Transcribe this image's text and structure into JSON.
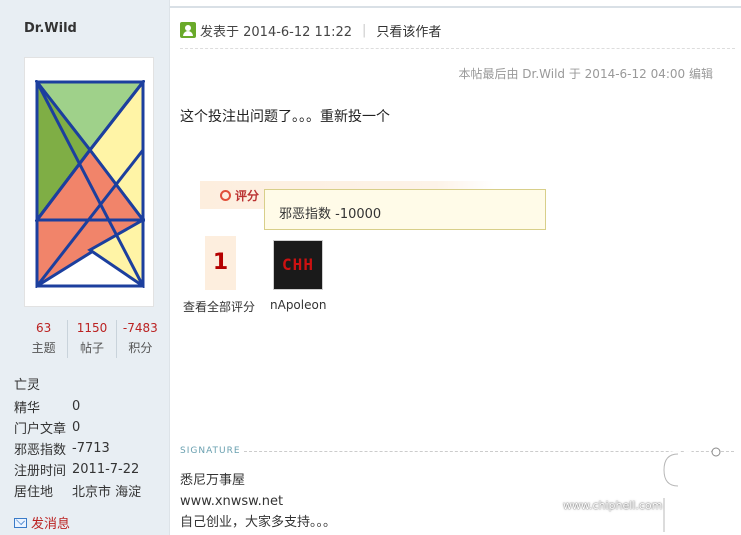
{
  "sidebar": {
    "username": "Dr.Wild",
    "stats": [
      {
        "value": "63",
        "label": "主题"
      },
      {
        "value": "1150",
        "label": "帖子"
      },
      {
        "value": "-7483",
        "label": "积分"
      }
    ],
    "rank": "亡灵",
    "profile": [
      {
        "key": "精华",
        "value": "0"
      },
      {
        "key": "门户文章",
        "value": "0"
      },
      {
        "key": "邪恶指数",
        "value": "-7713"
      },
      {
        "key": "注册时间",
        "value": "2011-7-22"
      },
      {
        "key": "居住地",
        "value": "北京市 海淀"
      }
    ],
    "send_message": "发消息"
  },
  "post": {
    "posted_at": "发表于 2014-6-12 11:22",
    "author_only": "只看该作者",
    "last_edited": "本帖最后由 Dr.Wild 于 2014-6-12 04:00 编辑",
    "content": "这个投注出问题了。。。重新投一个"
  },
  "rating": {
    "title": "评分",
    "count": "1",
    "view_all": "查看全部评分",
    "tooltip": "邪恶指数 -10000",
    "rater": {
      "name": "nApoleon",
      "avatar_text": "CHH"
    }
  },
  "signature": {
    "label": "SIGNATURE",
    "lines": [
      "悉尼万事屋",
      "www.xnwsw.net",
      "自己创业，大家多支持。。。"
    ]
  },
  "watermark": {
    "url": "www.chiphell.com"
  },
  "colors": {
    "accent": "#b22222",
    "sidebar_bg": "#e8eef3",
    "rate_bg": "#fdeede"
  }
}
